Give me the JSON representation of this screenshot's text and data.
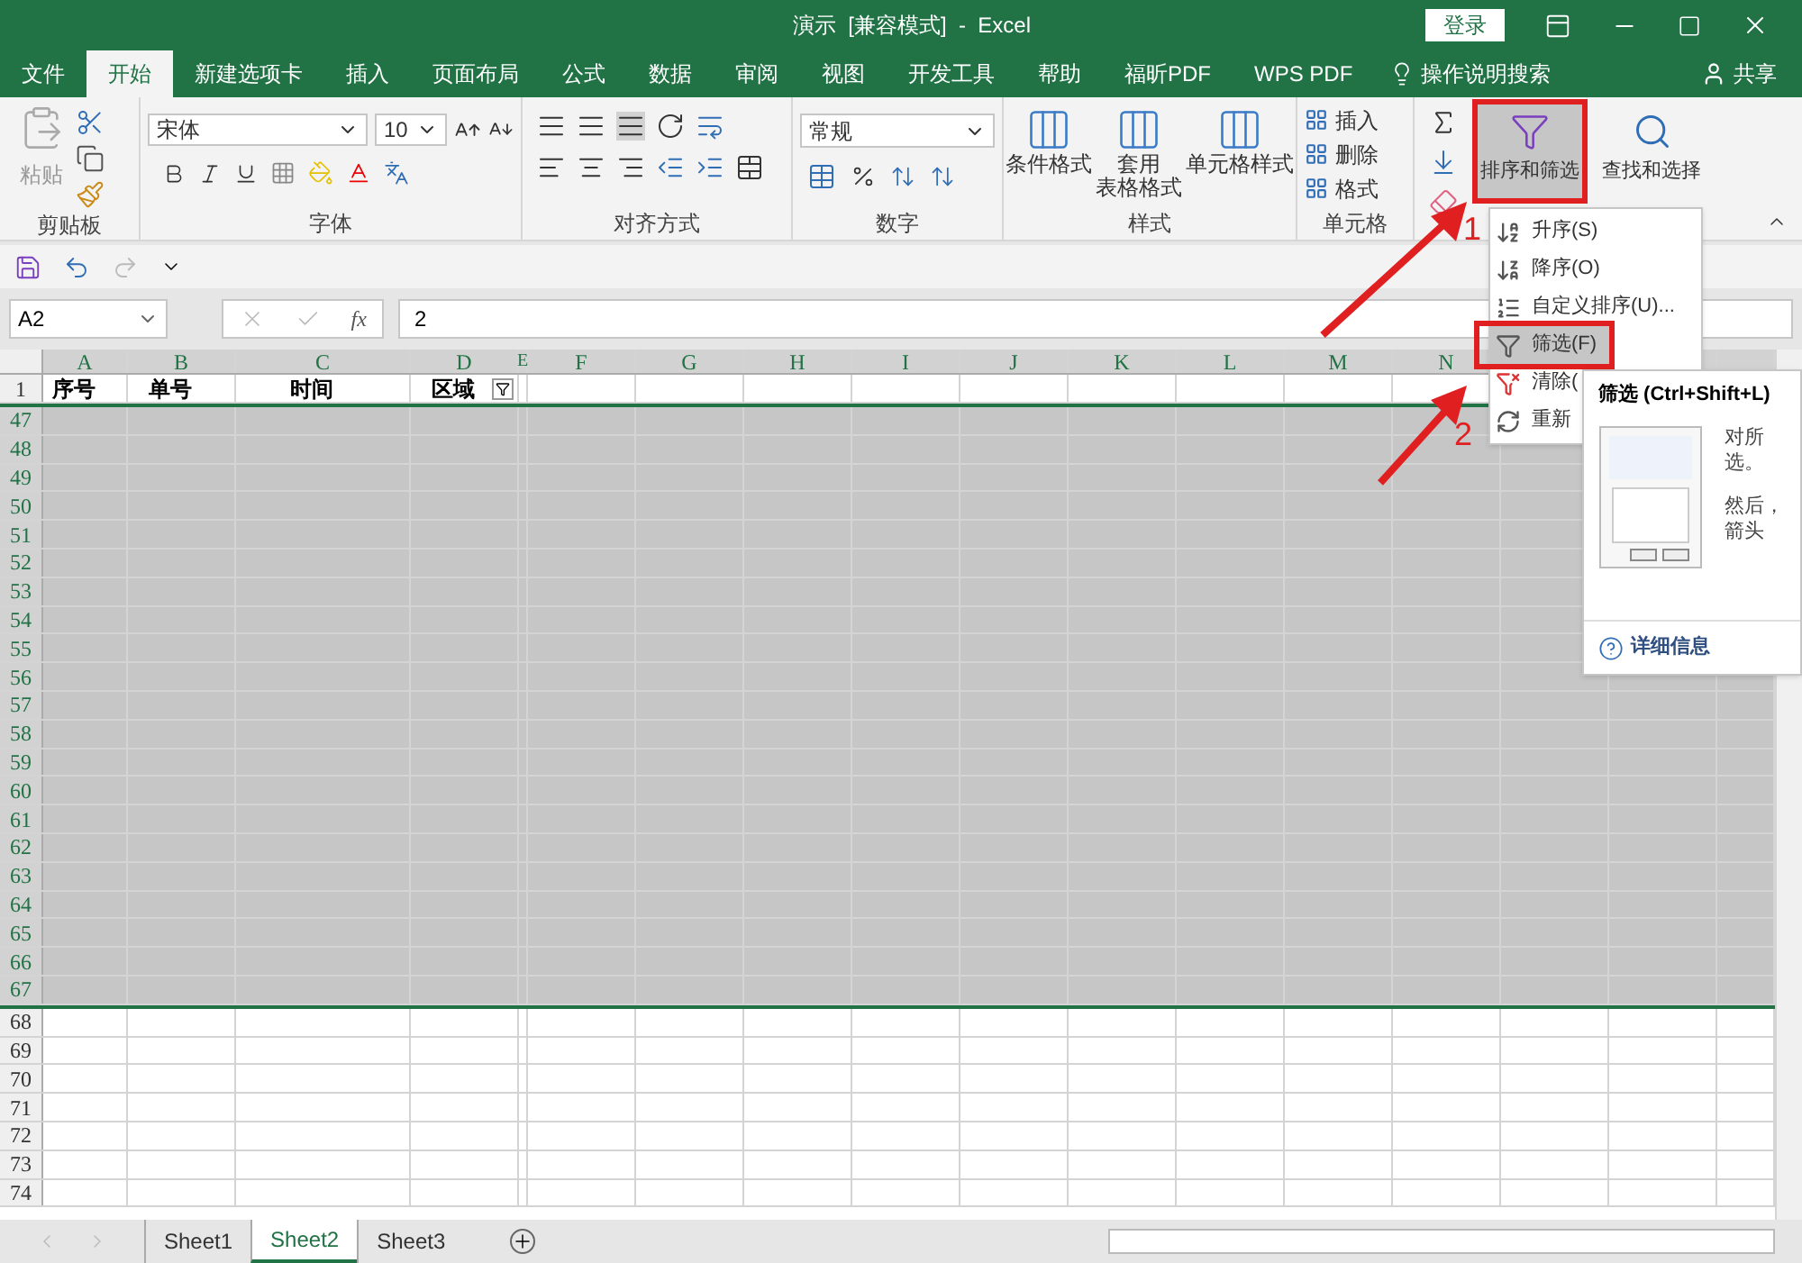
{
  "window": {
    "title": "演示  [兼容模式]  -  Excel",
    "sign_in": "登录"
  },
  "tabs": [
    {
      "label": "文件",
      "selected": false
    },
    {
      "label": "开始",
      "selected": true
    },
    {
      "label": "新建选项卡",
      "selected": false
    },
    {
      "label": "插入",
      "selected": false
    },
    {
      "label": "页面布局",
      "selected": false
    },
    {
      "label": "公式",
      "selected": false
    },
    {
      "label": "数据",
      "selected": false
    },
    {
      "label": "审阅",
      "selected": false
    },
    {
      "label": "视图",
      "selected": false
    },
    {
      "label": "开发工具",
      "selected": false
    },
    {
      "label": "帮助",
      "selected": false
    },
    {
      "label": "福昕PDF",
      "selected": false
    },
    {
      "label": "WPS PDF",
      "selected": false
    }
  ],
  "tell_me": "操作说明搜索",
  "share": "共享",
  "ribbon": {
    "clipboard": {
      "label": "剪贴板",
      "paste": "粘贴"
    },
    "font": {
      "label": "字体",
      "font_name": "宋体",
      "font_size": "10"
    },
    "alignment": {
      "label": "对齐方式"
    },
    "number": {
      "label": "数字",
      "format": "常规"
    },
    "styles": {
      "label": "样式",
      "buttons": [
        {
          "lines": [
            "条件格式"
          ]
        },
        {
          "lines": [
            "套用",
            "表格格式"
          ]
        },
        {
          "lines": [
            "单元格样式"
          ]
        }
      ]
    },
    "cells": {
      "label": "单元格",
      "buttons": [
        "插入",
        "删除",
        "格式"
      ]
    },
    "editing": {
      "sort_filter": "排序和筛选",
      "sort_filter_framed": true,
      "find_select": "查找和选择"
    }
  },
  "formula_bar": {
    "name_box": "A2",
    "fx": "fx",
    "value": "2"
  },
  "sheet": {
    "columns": [
      "A",
      "B",
      "C",
      "D",
      "E",
      "F",
      "G",
      "H",
      "I",
      "J",
      "K",
      "L",
      "M",
      "N"
    ],
    "header_row": {
      "number": "1",
      "cells": [
        {
          "text": "序号",
          "filter": false
        },
        {
          "text": "单号",
          "filter": false
        },
        {
          "text": "时间",
          "filter": false
        },
        {
          "text": "区域",
          "filter": true
        }
      ]
    },
    "rows": [
      {
        "number": "47",
        "selected": true
      },
      {
        "number": "48",
        "selected": true
      },
      {
        "number": "49",
        "selected": true
      },
      {
        "number": "50",
        "selected": true
      },
      {
        "number": "51",
        "selected": true
      },
      {
        "number": "52",
        "selected": true
      },
      {
        "number": "53",
        "selected": true
      },
      {
        "number": "54",
        "selected": true
      },
      {
        "number": "55",
        "selected": true
      },
      {
        "number": "56",
        "selected": true
      },
      {
        "number": "57",
        "selected": true
      },
      {
        "number": "58",
        "selected": true
      },
      {
        "number": "59",
        "selected": true
      },
      {
        "number": "60",
        "selected": true
      },
      {
        "number": "61",
        "selected": true
      },
      {
        "number": "62",
        "selected": true
      },
      {
        "number": "63",
        "selected": true
      },
      {
        "number": "64",
        "selected": true
      },
      {
        "number": "65",
        "selected": true
      },
      {
        "number": "66",
        "selected": true
      },
      {
        "number": "67",
        "selected": true
      },
      {
        "number": "68",
        "selected": false
      },
      {
        "number": "69",
        "selected": false
      },
      {
        "number": "70",
        "selected": false
      },
      {
        "number": "71",
        "selected": false
      },
      {
        "number": "72",
        "selected": false
      },
      {
        "number": "73",
        "selected": false
      },
      {
        "number": "74",
        "selected": false
      }
    ]
  },
  "sheet_tabs": [
    {
      "label": "Sheet1",
      "selected": false
    },
    {
      "label": "Sheet2",
      "selected": true
    },
    {
      "label": "Sheet3",
      "selected": false
    }
  ],
  "menu": {
    "items": [
      {
        "kind": "sort_asc",
        "label": "升序(S)",
        "selected": false,
        "framed": false
      },
      {
        "kind": "sort_desc",
        "label": "降序(O)",
        "selected": false,
        "framed": false
      },
      {
        "kind": "custom_sort",
        "label": "自定义排序(U)...",
        "selected": false,
        "framed": false
      },
      {
        "kind": "filter",
        "label": "筛选(F)",
        "selected": true,
        "framed": true
      },
      {
        "kind": "clear",
        "label": "清除(",
        "selected": false,
        "framed": false
      },
      {
        "kind": "reapply",
        "label": "重新",
        "selected": false,
        "framed": false
      }
    ]
  },
  "tooltip": {
    "title": "筛选 (Ctrl+Shift+L)",
    "lines": [
      "对所",
      "选。",
      "然后，",
      "箭头"
    ],
    "more": "详细信息"
  },
  "annotations": [
    "1",
    "2"
  ]
}
